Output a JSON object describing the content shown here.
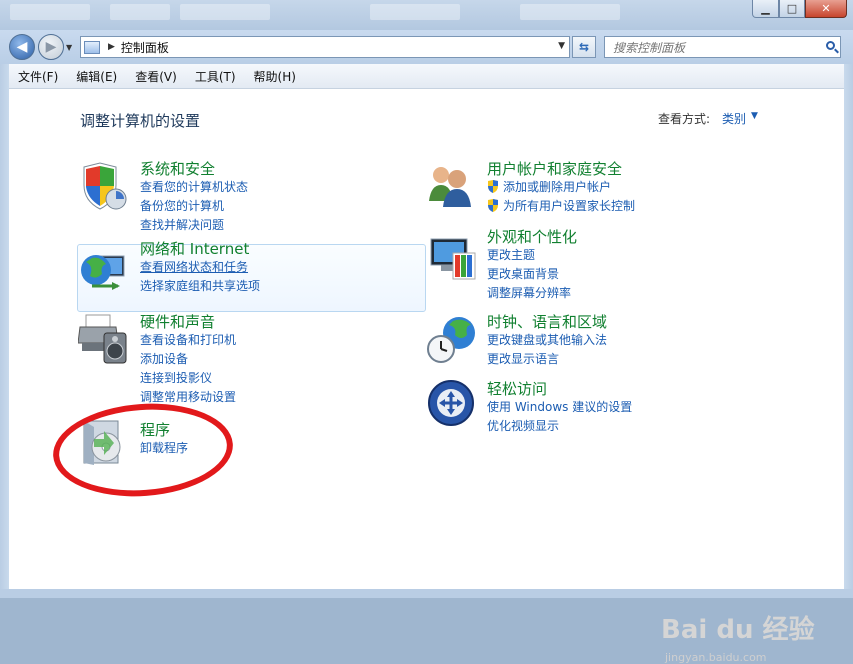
{
  "window": {
    "minimize_glyph": "▁",
    "maximize_glyph": "□",
    "close_glyph": "✕"
  },
  "navigation": {
    "address": "控制面板",
    "search_placeholder": "搜索控制面板"
  },
  "menu": [
    "文件(F)",
    "编辑(E)",
    "查看(V)",
    "工具(T)",
    "帮助(H)"
  ],
  "main": {
    "title": "调整计算机的设置",
    "view_by_label": "查看方式:",
    "view_by_value": "类别"
  },
  "categories": [
    {
      "title": "系统和安全",
      "icon": "shield-icon",
      "links": [
        "查看您的计算机状态",
        "备份您的计算机",
        "查找并解决问题"
      ]
    },
    {
      "title": "网络和 Internet",
      "icon": "network-globe-icon",
      "links": [
        "查看网络状态和任务",
        "选择家庭组和共享选项"
      ]
    },
    {
      "title": "硬件和声音",
      "icon": "printer-speaker-icon",
      "links": [
        "查看设备和打印机",
        "添加设备",
        "连接到投影仪",
        "调整常用移动设置"
      ]
    },
    {
      "title": "程序",
      "icon": "programs-disc-icon",
      "links": [
        "卸载程序"
      ]
    },
    {
      "title": "用户帐户和家庭安全",
      "icon": "users-icon",
      "links": [
        "添加或删除用户帐户",
        "为所有用户设置家长控制"
      ]
    },
    {
      "title": "外观和个性化",
      "icon": "monitor-palette-icon",
      "links": [
        "更改主题",
        "更改桌面背景",
        "调整屏幕分辨率"
      ]
    },
    {
      "title": "时钟、语言和区域",
      "icon": "clock-globe-icon",
      "links": [
        "更改键盘或其他输入法",
        "更改显示语言"
      ]
    },
    {
      "title": "轻松访问",
      "icon": "ease-of-access-icon",
      "links": [
        "使用 Windows 建议的设置",
        "优化视频显示"
      ]
    }
  ],
  "watermark": {
    "text": "Bai du 经验",
    "sub": "jingyan.baidu.com"
  },
  "colors": {
    "link": "#1c5db2",
    "category_title": "#118030",
    "annotation_circle": "#e2191b"
  }
}
